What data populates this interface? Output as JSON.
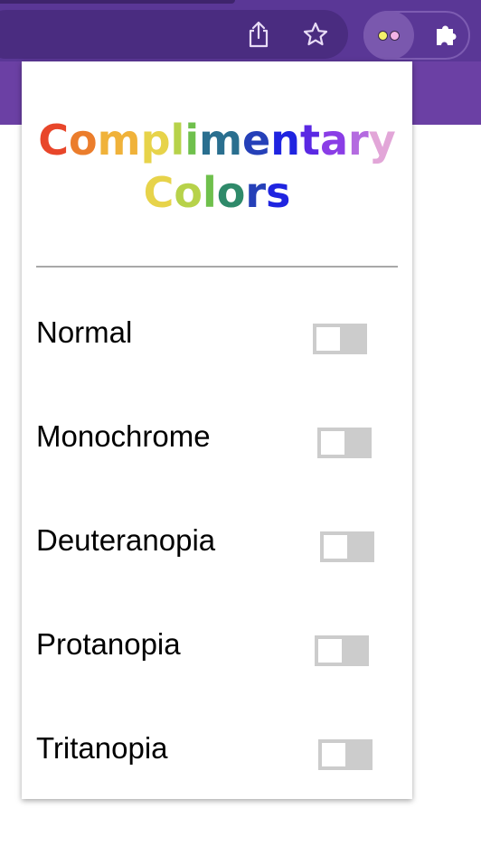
{
  "toolbar": {
    "icons": [
      "share-icon",
      "star-icon",
      "extension-icon",
      "puzzle-icon"
    ],
    "extension_dots": [
      "#f5f06a",
      "#f2b3e6"
    ]
  },
  "popup": {
    "title_line1": "Complimentary",
    "title_line2": "Colors",
    "title_colors": [
      "#e8462a",
      "#eb7d2c",
      "#f0b23a",
      "#e7d34a",
      "#b7d24a",
      "#6fc04c",
      "#2f9a61",
      "#2a6f8f",
      "#2540b8",
      "#1f24e0",
      "#5a28e3",
      "#8a3de6",
      "#b46be0",
      "#e2a6d8"
    ],
    "options": [
      {
        "label": "Normal",
        "enabled": false
      },
      {
        "label": "Monochrome",
        "enabled": false
      },
      {
        "label": "Deuteranopia",
        "enabled": false
      },
      {
        "label": "Protanopia",
        "enabled": false
      },
      {
        "label": "Tritanopia",
        "enabled": false
      }
    ]
  }
}
